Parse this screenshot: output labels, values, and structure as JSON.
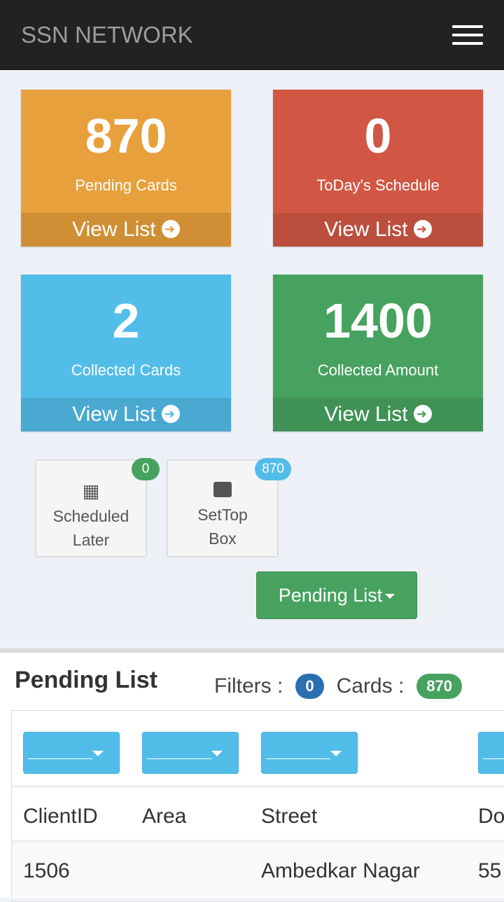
{
  "navbar": {
    "brand": "SSN NETWORK",
    "menu_icon": "hamburger-icon"
  },
  "tiles": [
    {
      "value": "870",
      "label": "Pending Cards",
      "link": "View List",
      "color": "#e8a03c"
    },
    {
      "value": "0",
      "label": "ToDay's Schedule",
      "link": "View List",
      "color": "#d15744"
    },
    {
      "value": "2",
      "label": "Collected Cards",
      "link": "View List",
      "color": "#53bde9"
    },
    {
      "value": "1400",
      "label": "Collected Amount",
      "link": "View List",
      "color": "#47a25f"
    }
  ],
  "shortcuts": [
    {
      "line1": "Scheduled",
      "line2": "Later",
      "badge": "0",
      "badge_color": "#47a25f",
      "icon": "calendar-icon"
    },
    {
      "line1": "SetTop",
      "line2": "Box",
      "badge": "870",
      "badge_color": "#53bde9",
      "icon": "inbox-icon"
    }
  ],
  "dropdown": {
    "label": "Pending List"
  },
  "panel": {
    "title": "Pending List",
    "filters_label": "Filters :",
    "filters_count": "0",
    "cards_label": "Cards :",
    "cards_count": "870"
  },
  "table": {
    "headers": [
      "ClientID",
      "Area",
      "Street",
      "Do"
    ],
    "rows": [
      [
        "1506",
        "",
        "Ambedkar Nagar",
        "55"
      ]
    ]
  }
}
